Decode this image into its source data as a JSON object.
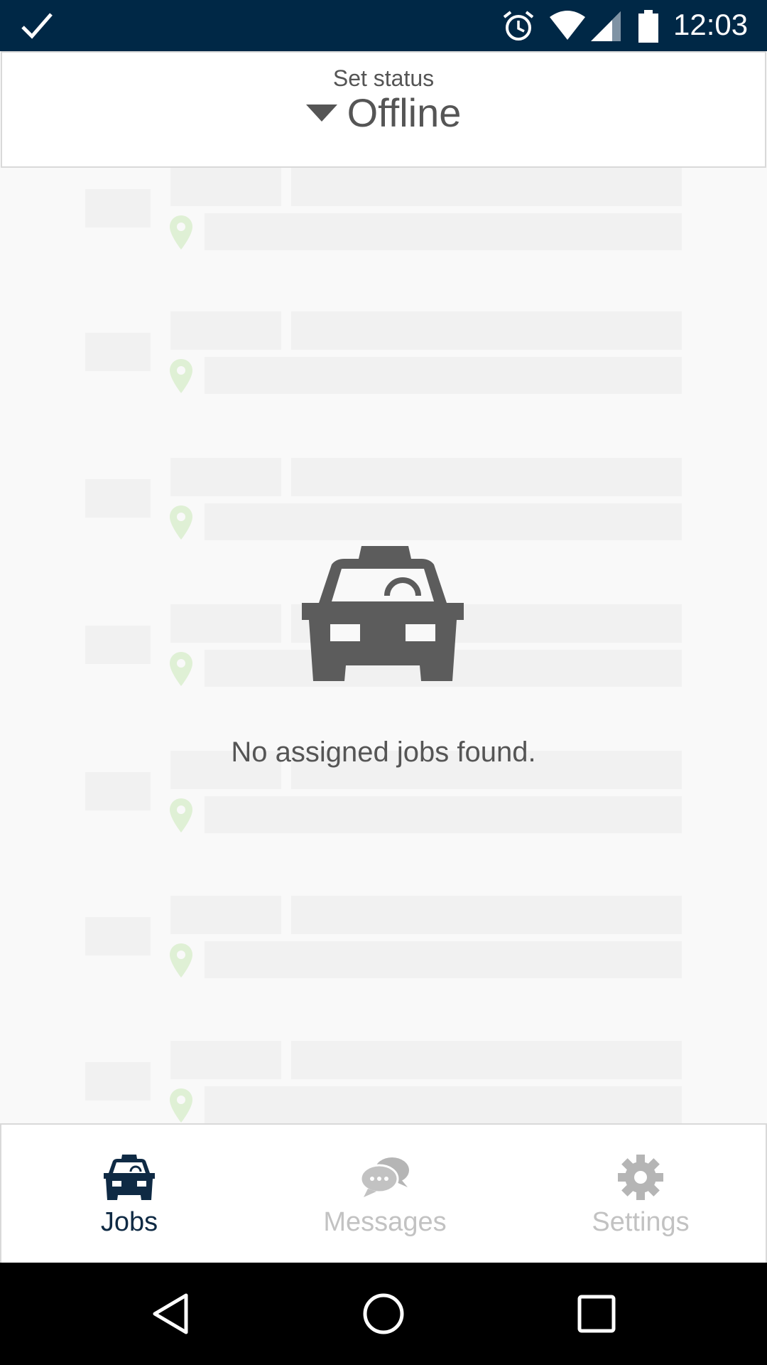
{
  "status_bar": {
    "time": "12:03",
    "icons": [
      "check-icon",
      "alarm-icon",
      "wifi-icon",
      "signal-icon",
      "battery-icon"
    ],
    "background": "#002846"
  },
  "header": {
    "label": "Set status",
    "status_value": "Offline"
  },
  "empty_state": {
    "icon": "taxi-icon",
    "message": "No assigned jobs found."
  },
  "tabs": [
    {
      "label": "Jobs",
      "icon": "taxi-icon",
      "active": true,
      "color": "#0f2a44"
    },
    {
      "label": "Messages",
      "icon": "chat-bubbles-icon",
      "active": false,
      "color": "#c2c2c2"
    },
    {
      "label": "Settings",
      "icon": "gear-icon",
      "active": false,
      "color": "#c2c2c2"
    }
  ],
  "nav_bar": {
    "buttons": [
      "back-icon",
      "home-icon",
      "recents-icon"
    ]
  },
  "colors": {
    "placeholder": "#f1f1f1",
    "pin": "#dff0d5",
    "text": "#555555"
  }
}
